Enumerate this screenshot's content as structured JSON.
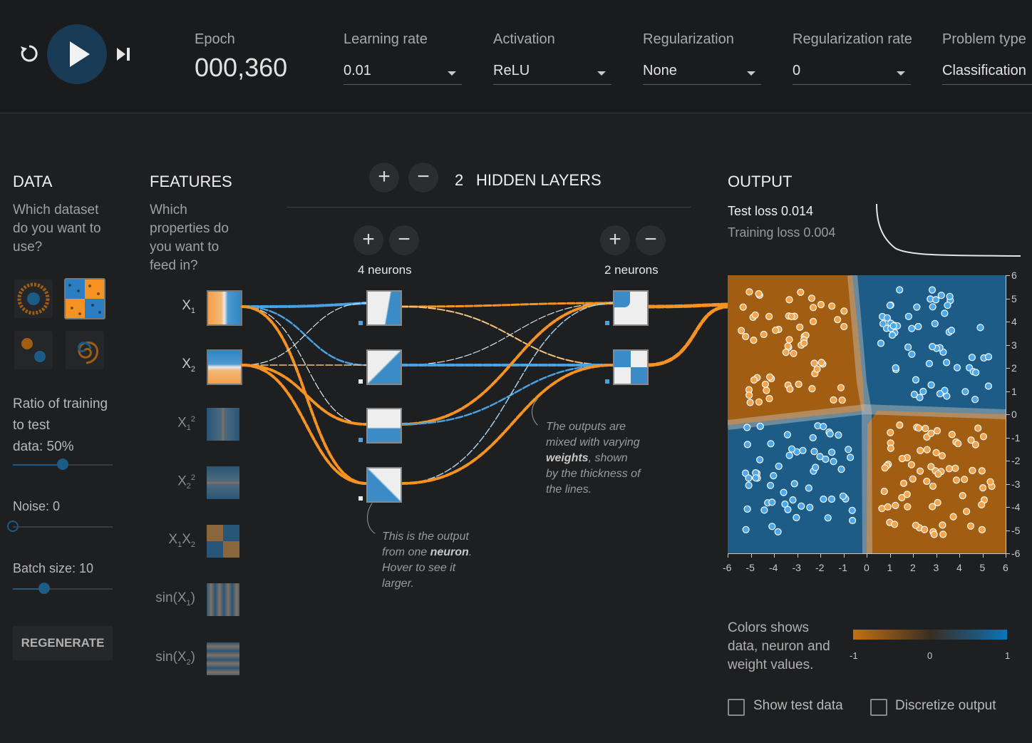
{
  "header": {
    "epoch_label": "Epoch",
    "epoch_value": "000,360",
    "learning_rate": {
      "label": "Learning rate",
      "value": "0.01"
    },
    "activation": {
      "label": "Activation",
      "value": "ReLU"
    },
    "regularization": {
      "label": "Regularization",
      "value": "None"
    },
    "regularization_rate": {
      "label": "Regularization rate",
      "value": "0"
    },
    "problem_type": {
      "label": "Problem type",
      "value": "Classification"
    }
  },
  "data_panel": {
    "title": "DATA",
    "question": [
      "Which dataset",
      "do you want to",
      "use?"
    ],
    "ratio_label": [
      "Ratio of training",
      "to test",
      "data:  50%"
    ],
    "ratio_value": 0.5,
    "noise_label": "Noise:  0",
    "noise_value": 0,
    "batch_label": "Batch size:  10",
    "batch_value": 0.3,
    "regenerate": "REGENERATE"
  },
  "features_panel": {
    "title": "FEATURES",
    "question": [
      "Which",
      "properties do",
      "you want to",
      "feed in?"
    ],
    "features": [
      {
        "label": "X1",
        "active": true
      },
      {
        "label": "X2",
        "active": true
      },
      {
        "label": "X1²",
        "active": false
      },
      {
        "label": "X2²",
        "active": false
      },
      {
        "label": "X1X2",
        "active": false
      },
      {
        "label": "sin(X1)",
        "active": false
      },
      {
        "label": "sin(X2)",
        "active": false
      }
    ]
  },
  "hidden": {
    "count": "2",
    "title": "HIDDEN LAYERS",
    "layer1_label": "4 neurons",
    "layer2_label": "2 neurons",
    "note1": [
      "This is the output",
      "from one ",
      "neuron",
      ".",
      "Hover to see it",
      "larger."
    ],
    "note2": [
      "The outputs are",
      "mixed with varying",
      "weights",
      ", shown",
      "by the thickness of",
      "the lines."
    ]
  },
  "output": {
    "title": "OUTPUT",
    "test_loss": "Test loss 0.014",
    "training_loss": "Training loss 0.004",
    "x_ticks": [
      "-6",
      "-5",
      "-4",
      "-3",
      "-2",
      "-1",
      "0",
      "1",
      "2",
      "3",
      "4",
      "5",
      "6"
    ],
    "y_ticks": [
      "6",
      "5",
      "4",
      "3",
      "2",
      "1",
      "0",
      "-1",
      "-2",
      "-3",
      "-4",
      "-5",
      "-6"
    ],
    "legend_text": [
      "Colors shows",
      "data, neuron and",
      "weight values."
    ],
    "legend_ticks": [
      "-1",
      "0",
      "1"
    ],
    "show_test": "Show test data",
    "discretize": "Discretize output"
  },
  "colors": {
    "orange": "#f59322",
    "blue": "#0877bd",
    "dark_orange": "#a15d12",
    "dark_blue": "#1b5b86"
  }
}
